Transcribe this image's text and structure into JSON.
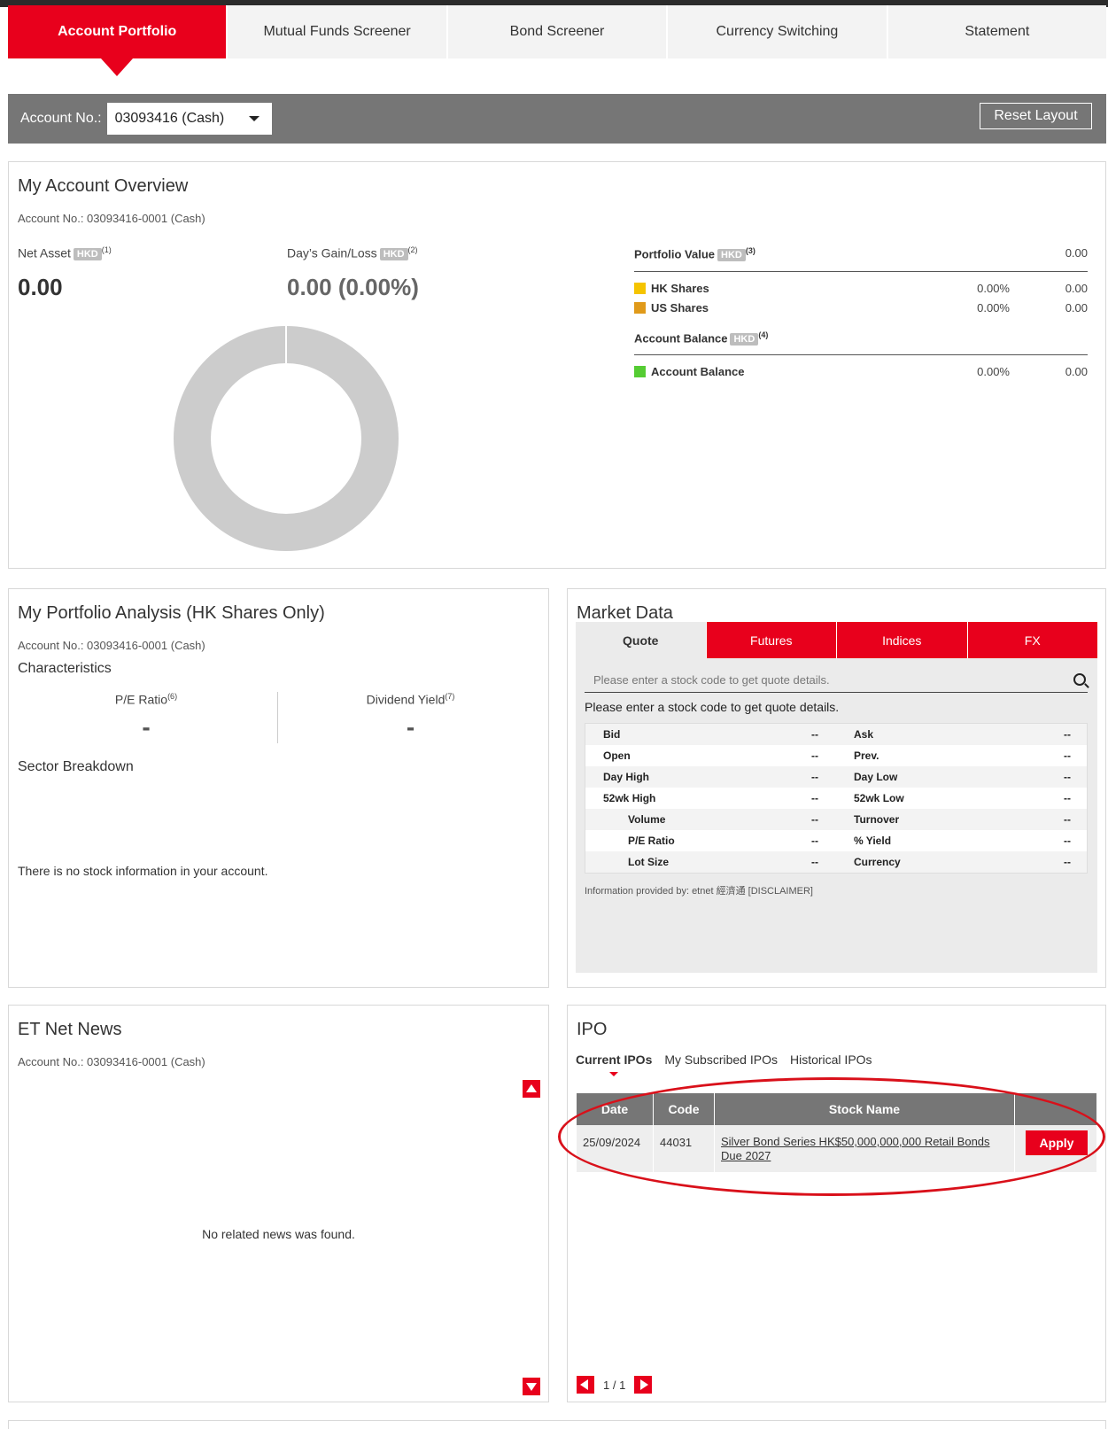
{
  "tabs": [
    {
      "label": "Account Portfolio",
      "active": true
    },
    {
      "label": "Mutual Funds Screener"
    },
    {
      "label": "Bond Screener"
    },
    {
      "label": "Currency Switching"
    },
    {
      "label": "Statement"
    }
  ],
  "account_bar": {
    "label": "Account No.:",
    "selected": "03093416 (Cash)",
    "reset_label": "Reset Layout"
  },
  "overview": {
    "title": "My Account Overview",
    "account": "Account No.: 03093416-0001 (Cash)",
    "net_asset_label": "Net Asset",
    "net_asset_currency": "HKD",
    "net_asset_note": "(1)",
    "net_asset_value": "0.00",
    "gain_label": "Day’s Gain/Loss",
    "gain_currency": "HKD",
    "gain_note": "(2)",
    "gain_value": "0.00 (0.00%)",
    "portfolio_value_label": "Portfolio Value",
    "portfolio_value_currency": "HKD",
    "portfolio_value_note": "(3)",
    "portfolio_value": "0.00",
    "rows": [
      {
        "name": "HK Shares",
        "pct": "0.00%",
        "val": "0.00",
        "color": "#f5c400"
      },
      {
        "name": "US Shares",
        "pct": "0.00%",
        "val": "0.00",
        "color": "#e09a1a"
      }
    ],
    "balance_label": "Account Balance",
    "balance_currency": "HKD",
    "balance_note": "(4)",
    "balance_row": {
      "name": "Account Balance",
      "pct": "0.00%",
      "val": "0.00",
      "color": "#55cc33"
    }
  },
  "analysis": {
    "title": "My Portfolio Analysis (HK Shares Only)",
    "account": "Account No.: 03093416-0001 (Cash)",
    "characteristics": "Characteristics",
    "pe_label": "P/E Ratio",
    "pe_note": "(6)",
    "pe_value": "-",
    "yield_label": "Dividend Yield",
    "yield_note": "(7)",
    "yield_value": "-",
    "sector": "Sector Breakdown",
    "empty": "There is no stock information in your account."
  },
  "market": {
    "title": "Market Data",
    "tabs": [
      "Quote",
      "Futures",
      "Indices",
      "FX"
    ],
    "search_placeholder": "Please enter a stock code to get quote details.",
    "note": "Please enter a stock code to get quote details.",
    "rows": [
      {
        "l1": "Bid",
        "v1": "--",
        "l2": "Ask",
        "v2": "--"
      },
      {
        "l1": "Open",
        "v1": "--",
        "l2": "Prev.",
        "v2": "--"
      },
      {
        "l1": "Day High",
        "v1": "--",
        "l2": "Day Low",
        "v2": "--"
      },
      {
        "l1": "52wk High",
        "v1": "--",
        "l2": "52wk Low",
        "v2": "--"
      },
      {
        "l1": "Volume",
        "v1": "--",
        "l2": "Turnover",
        "v2": "--"
      },
      {
        "l1": "P/E Ratio",
        "v1": "--",
        "l2": "% Yield",
        "v2": "--"
      },
      {
        "l1": "Lot Size",
        "v1": "--",
        "l2": "Currency",
        "v2": "--"
      }
    ],
    "footer": "Information provided by: etnet 經濟通 [DISCLAIMER]"
  },
  "news": {
    "title": "ET Net News",
    "account": "Account No.: 03093416-0001 (Cash)",
    "empty": "No related news was found."
  },
  "ipo": {
    "title": "IPO",
    "tabs": [
      "Current IPOs",
      "My Subscribed IPOs",
      "Historical IPOs"
    ],
    "headers": [
      "Date",
      "Code",
      "Stock Name",
      ""
    ],
    "row": {
      "date": "25/09/2024",
      "code": "44031",
      "name": "Silver Bond Series HK$50,000,000,000 Retail Bonds Due 2027",
      "action": "Apply"
    },
    "pager": "1 / 1"
  },
  "colors": {
    "brand_red": "#e8001c",
    "bar_grey": "#767676",
    "donut_grey": "#cccccc"
  }
}
